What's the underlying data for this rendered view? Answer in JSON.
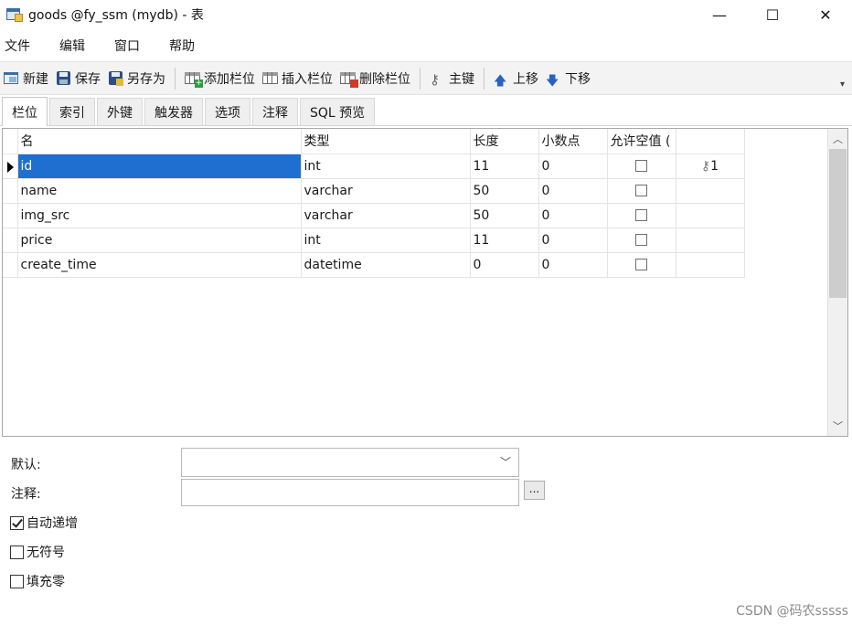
{
  "window": {
    "title": "goods @fy_ssm (mydb) - 表",
    "controls": {
      "minimize": "—",
      "maximize": "☐",
      "close": "✕"
    }
  },
  "menu": [
    "文件",
    "编辑",
    "窗口",
    "帮助"
  ],
  "toolbar": {
    "new": "新建",
    "save": "保存",
    "save_as": "另存为",
    "add_column": "添加栏位",
    "insert_column": "插入栏位",
    "delete_column": "删除栏位",
    "primary_key": "主键",
    "move_up": "上移",
    "move_down": "下移"
  },
  "tabs": [
    "栏位",
    "索引",
    "外键",
    "触发器",
    "选项",
    "注释",
    "SQL 预览"
  ],
  "active_tab": "栏位",
  "grid": {
    "headers": [
      "名",
      "类型",
      "长度",
      "小数点",
      "允许空值 (",
      ""
    ],
    "rows": [
      {
        "name": "id",
        "type": "int",
        "length": "11",
        "decimals": "0",
        "nullable": false,
        "key": "1",
        "selected": true
      },
      {
        "name": "name",
        "type": "varchar",
        "length": "50",
        "decimals": "0",
        "nullable": false,
        "key": ""
      },
      {
        "name": "img_src",
        "type": "varchar",
        "length": "50",
        "decimals": "0",
        "nullable": false,
        "key": ""
      },
      {
        "name": "price",
        "type": "int",
        "length": "11",
        "decimals": "0",
        "nullable": false,
        "key": ""
      },
      {
        "name": "create_time",
        "type": "datetime",
        "length": "0",
        "decimals": "0",
        "nullable": false,
        "key": ""
      }
    ]
  },
  "properties": {
    "default_label": "默认:",
    "default_value": "",
    "comment_label": "注释:",
    "comment_value": "",
    "ellipsis": "...",
    "auto_increment_label": "自动递增",
    "auto_increment": true,
    "unsigned_label": "无符号",
    "unsigned": false,
    "zerofill_label": "填充零",
    "zerofill": false
  },
  "watermark": "CSDN @码农sssss"
}
